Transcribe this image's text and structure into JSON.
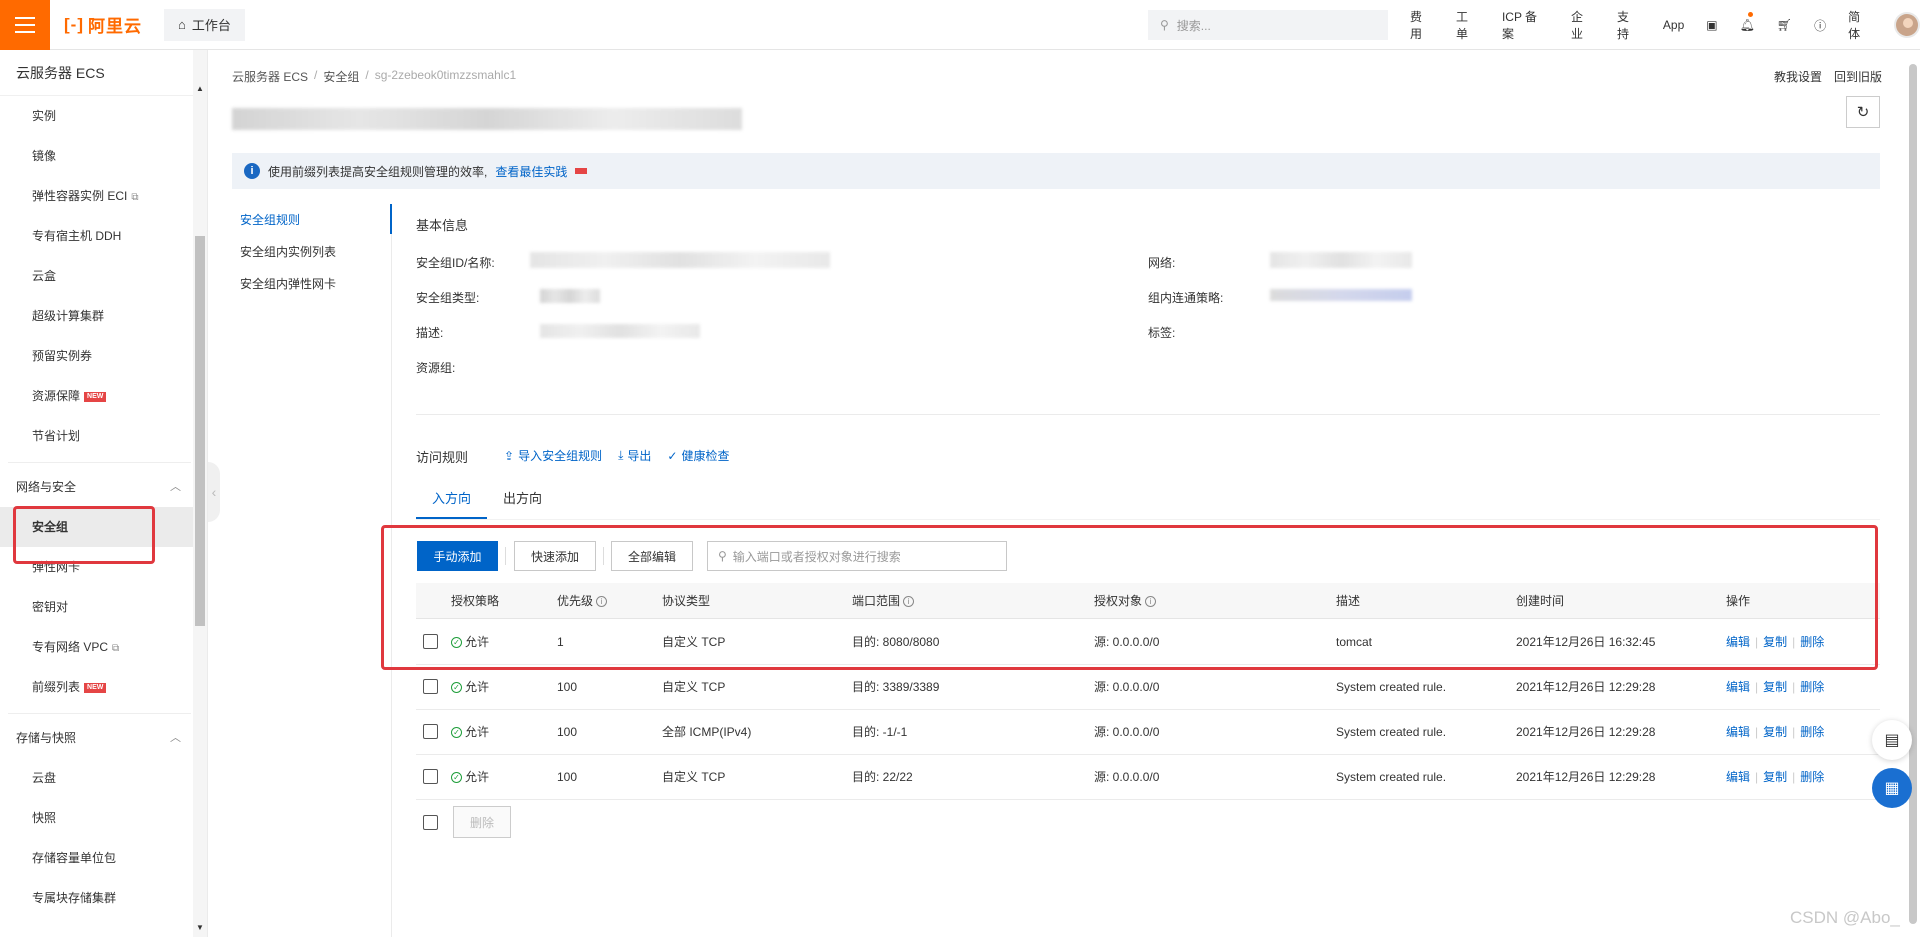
{
  "topbar": {
    "brand": "阿里云",
    "workbench": "工作台",
    "search_placeholder": "搜索...",
    "nav": [
      "费用",
      "工单",
      "ICP 备案",
      "企业",
      "支持",
      "App"
    ],
    "lang": "简体"
  },
  "sidebar": {
    "title": "云服务器 ECS",
    "items_top": [
      {
        "label": "实例"
      },
      {
        "label": "镜像"
      },
      {
        "label": "弹性容器实例 ECI",
        "external": true
      },
      {
        "label": "专有宿主机 DDH"
      },
      {
        "label": "云盒"
      },
      {
        "label": "超级计算集群"
      },
      {
        "label": "预留实例券"
      },
      {
        "label": "资源保障",
        "badge": "NEW"
      },
      {
        "label": "节省计划"
      }
    ],
    "group_network": "网络与安全",
    "items_network": [
      {
        "label": "安全组",
        "active": true
      },
      {
        "label": "弹性网卡"
      },
      {
        "label": "密钥对"
      },
      {
        "label": "专有网络 VPC",
        "external": true
      },
      {
        "label": "前缀列表",
        "badge": "NEW"
      }
    ],
    "group_storage": "存储与快照",
    "items_storage": [
      {
        "label": "云盘"
      },
      {
        "label": "快照"
      },
      {
        "label": "存储容量单位包"
      },
      {
        "label": "专属块存储集群"
      }
    ]
  },
  "breadcrumb": [
    "云服务器 ECS",
    "安全组",
    "sg-2zebeok0timzzsmahlc1"
  ],
  "top_links": [
    "教我设置",
    "回到旧版"
  ],
  "notice": {
    "text": "使用前缀列表提高安全组规则管理的效率,",
    "link": "查看最佳实践"
  },
  "subnav": [
    "安全组规则",
    "安全组内实例列表",
    "安全组内弹性网卡"
  ],
  "basic_info": {
    "title": "基本信息",
    "labels_left": [
      "安全组ID/名称:",
      "安全组类型:",
      "描述:",
      "资源组:"
    ],
    "labels_right": [
      "网络:",
      "组内连通策略:",
      "标签:"
    ]
  },
  "rules": {
    "title": "访问规则",
    "actions": [
      "导入安全组规则",
      "导出",
      "健康检查"
    ],
    "tabs": [
      "入方向",
      "出方向"
    ],
    "toolbar": {
      "manual_add": "手动添加",
      "quick_add": "快速添加",
      "edit_all": "全部编辑",
      "search_placeholder": "输入端口或者授权对象进行搜索"
    },
    "columns": [
      "授权策略",
      "优先级",
      "协议类型",
      "端口范围",
      "授权对象",
      "描述",
      "创建时间",
      "操作"
    ],
    "rows": [
      {
        "policy": "允许",
        "priority": "1",
        "protocol": "自定义 TCP",
        "port": "目的: 8080/8080",
        "source": "源: 0.0.0.0/0",
        "desc": "tomcat",
        "created": "2021年12月26日 16:32:45"
      },
      {
        "policy": "允许",
        "priority": "100",
        "protocol": "自定义 TCP",
        "port": "目的: 3389/3389",
        "source": "源: 0.0.0.0/0",
        "desc": "System created rule.",
        "created": "2021年12月26日 12:29:28"
      },
      {
        "policy": "允许",
        "priority": "100",
        "protocol": "全部 ICMP(IPv4)",
        "port": "目的: -1/-1",
        "source": "源: 0.0.0.0/0",
        "desc": "System created rule.",
        "created": "2021年12月26日 12:29:28"
      },
      {
        "policy": "允许",
        "priority": "100",
        "protocol": "自定义 TCP",
        "port": "目的: 22/22",
        "source": "源: 0.0.0.0/0",
        "desc": "System created rule.",
        "created": "2021年12月26日 12:29:28"
      }
    ],
    "row_ops": [
      "编辑",
      "复制",
      "删除"
    ],
    "bulk_delete": "删除"
  },
  "watermark": "CSDN @Abo_",
  "colors": {
    "brand": "#ff6a00",
    "primary": "#0064c8",
    "highlight": "#e0383e",
    "allow": "#1e9e3a"
  }
}
